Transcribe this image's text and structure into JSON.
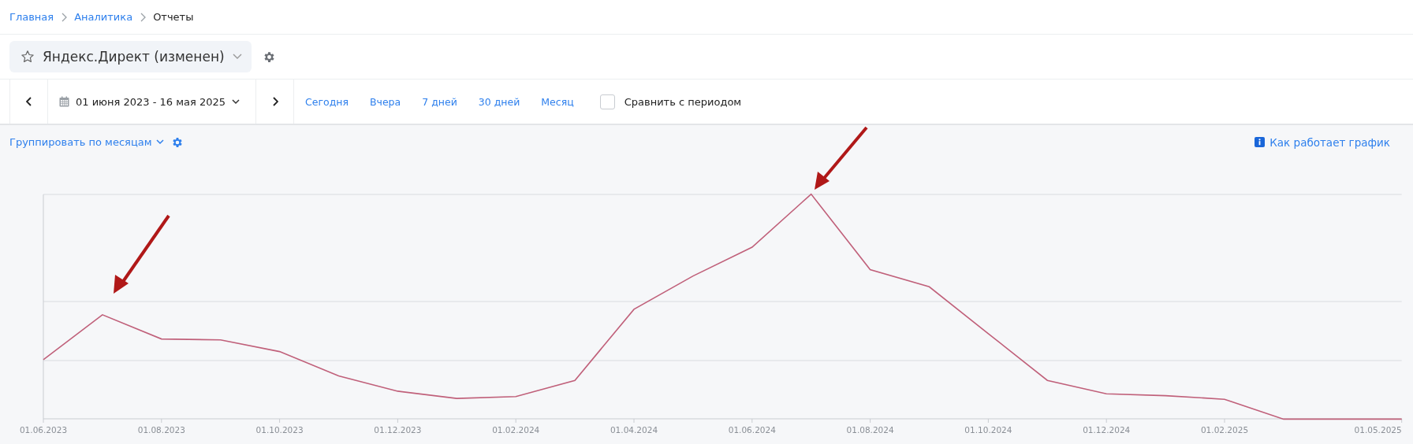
{
  "breadcrumbs": [
    {
      "label": "Главная",
      "kind": "link"
    },
    {
      "label": "Аналитика",
      "kind": "link"
    },
    {
      "label": "Отчеты",
      "kind": "current"
    }
  ],
  "report": {
    "title": "Яндекс.Директ (изменен)",
    "starred": false
  },
  "period": {
    "range": "01 июня 2023 - 16 мая 2025"
  },
  "presets": [
    "Сегодня",
    "Вчера",
    "7 дней",
    "30 дней",
    "Месяц"
  ],
  "compare": {
    "label": "Сравнить с периодом",
    "checked": false
  },
  "grouping": {
    "label": "Группировать по месяцам"
  },
  "help_link": "Как работает график",
  "chart": {
    "x_labels": [
      "01.06.2023",
      "01.08.2023",
      "01.10.2023",
      "01.12.2023",
      "01.02.2024",
      "01.04.2024",
      "01.06.2024",
      "01.08.2024",
      "01.10.2024",
      "01.12.2024",
      "01.02.2025",
      "01.05.2025"
    ]
  }
}
